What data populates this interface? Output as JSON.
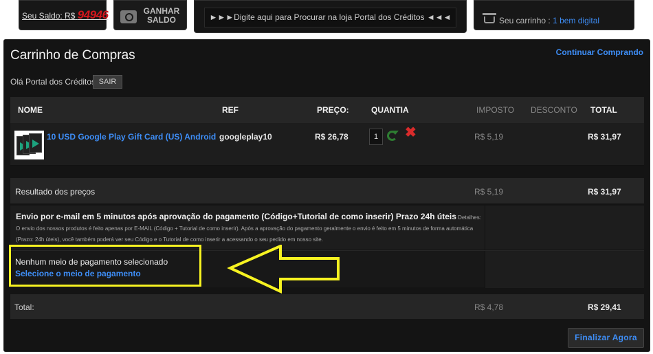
{
  "topbar": {
    "saldo_label": "Seu Saldo: R$",
    "saldo_value": "94946",
    "ganhar_label": "GANHAR SALDO",
    "search_text": "►►►Digite aqui para Procurar na loja Portal dos Créditos ◄◄◄",
    "cart_label": "Seu carrinho :",
    "cart_link": "1 bem digital"
  },
  "page": {
    "title": "Carrinho de Compras",
    "continue_link": "Continuar Comprando",
    "greeting": "Olá Portal dos Créditos",
    "sair_button": "SAIR"
  },
  "table": {
    "headers": {
      "nome": "NOME",
      "ref": "REF",
      "preco": "PREÇO:",
      "quantia": "QUANTIA",
      "imposto": "IMPOSTO",
      "desconto": "DESCONTO",
      "total": "TOTAL"
    },
    "item": {
      "name": "10 USD Google Play Gift Card (US) Android",
      "ref": "googleplay10",
      "price": "R$ 26,78",
      "quantity": "1",
      "tax": "R$ 5,19",
      "total": "R$ 31,97"
    }
  },
  "result": {
    "label": "Resultado dos preços",
    "tax": "R$ 5,19",
    "total": "R$ 31,97"
  },
  "shipping": {
    "title": "Envio por e-mail em 5 minutos após aprovação do pagamento (Código+Tutorial de como inserir) Prazo 24h úteis",
    "details": "Detalhes: O envio dos nossos produtos é feito apenas por E-MAIL (Código + Tutorial de como inserir). Após a aprovação do pagamento geralmente o envio é feito em 5 minutos de forma automática (Prazo: 24h úteis), você também poderá ver seu Código e o Tutorial de como inserir a acessando o seu pedido em nosso site."
  },
  "payment": {
    "none_selected": "Nenhum meio de pagamento selecionado",
    "select_link": "Selecione o meio de pagamento"
  },
  "totals": {
    "label": "Total:",
    "tax": "R$ 4,78",
    "total": "R$ 29,41"
  },
  "actions": {
    "finalize_button": "Finalizar Agora"
  },
  "colors": {
    "link": "#3e8ef7",
    "highlight": "#f7f321",
    "balance": "#d4161c",
    "delete": "#d92b2b",
    "refresh": "#2e7d32"
  }
}
